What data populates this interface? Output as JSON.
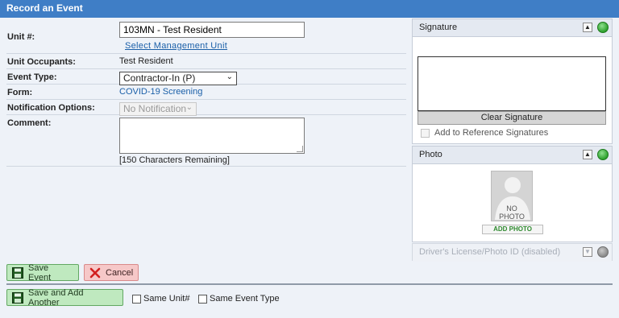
{
  "header": {
    "title": "Record an Event"
  },
  "form": {
    "unit": {
      "label": "Unit #:",
      "value": "103MN - Test Resident",
      "select_link": "Select Management Unit"
    },
    "occupants": {
      "label": "Unit Occupants:",
      "value": "Test Resident"
    },
    "event_type": {
      "label": "Event Type:",
      "value": "Contractor-In (P)"
    },
    "form_field": {
      "label": "Form:",
      "value": "COVID-19 Screening"
    },
    "notification": {
      "label": "Notification Options:",
      "value": "No Notification"
    },
    "comment": {
      "label": "Comment:",
      "value": "",
      "remaining": "[150 Characters Remaining]"
    }
  },
  "signature_panel": {
    "title": "Signature",
    "clear_label": "Clear Signature",
    "reference_label": "Add to Reference Signatures",
    "status_color": "#2ea12e"
  },
  "photo_panel": {
    "title": "Photo",
    "placeholder_line1": "NO",
    "placeholder_line2": "PHOTO",
    "add_label": "ADD PHOTO",
    "status_color": "#2ea12e"
  },
  "license_panel": {
    "title": "Driver's License/Photo ID (disabled)"
  },
  "actions": {
    "save": "Save Event",
    "cancel": "Cancel",
    "save_add": "Save and Add Another",
    "same_unit": "Same Unit#",
    "same_event_type": "Same Event Type"
  },
  "icons": {
    "save": "floppy-disk-icon",
    "cancel": "red-x-icon",
    "collapse": "chevron-up-icon",
    "status": "green-status-icon"
  }
}
